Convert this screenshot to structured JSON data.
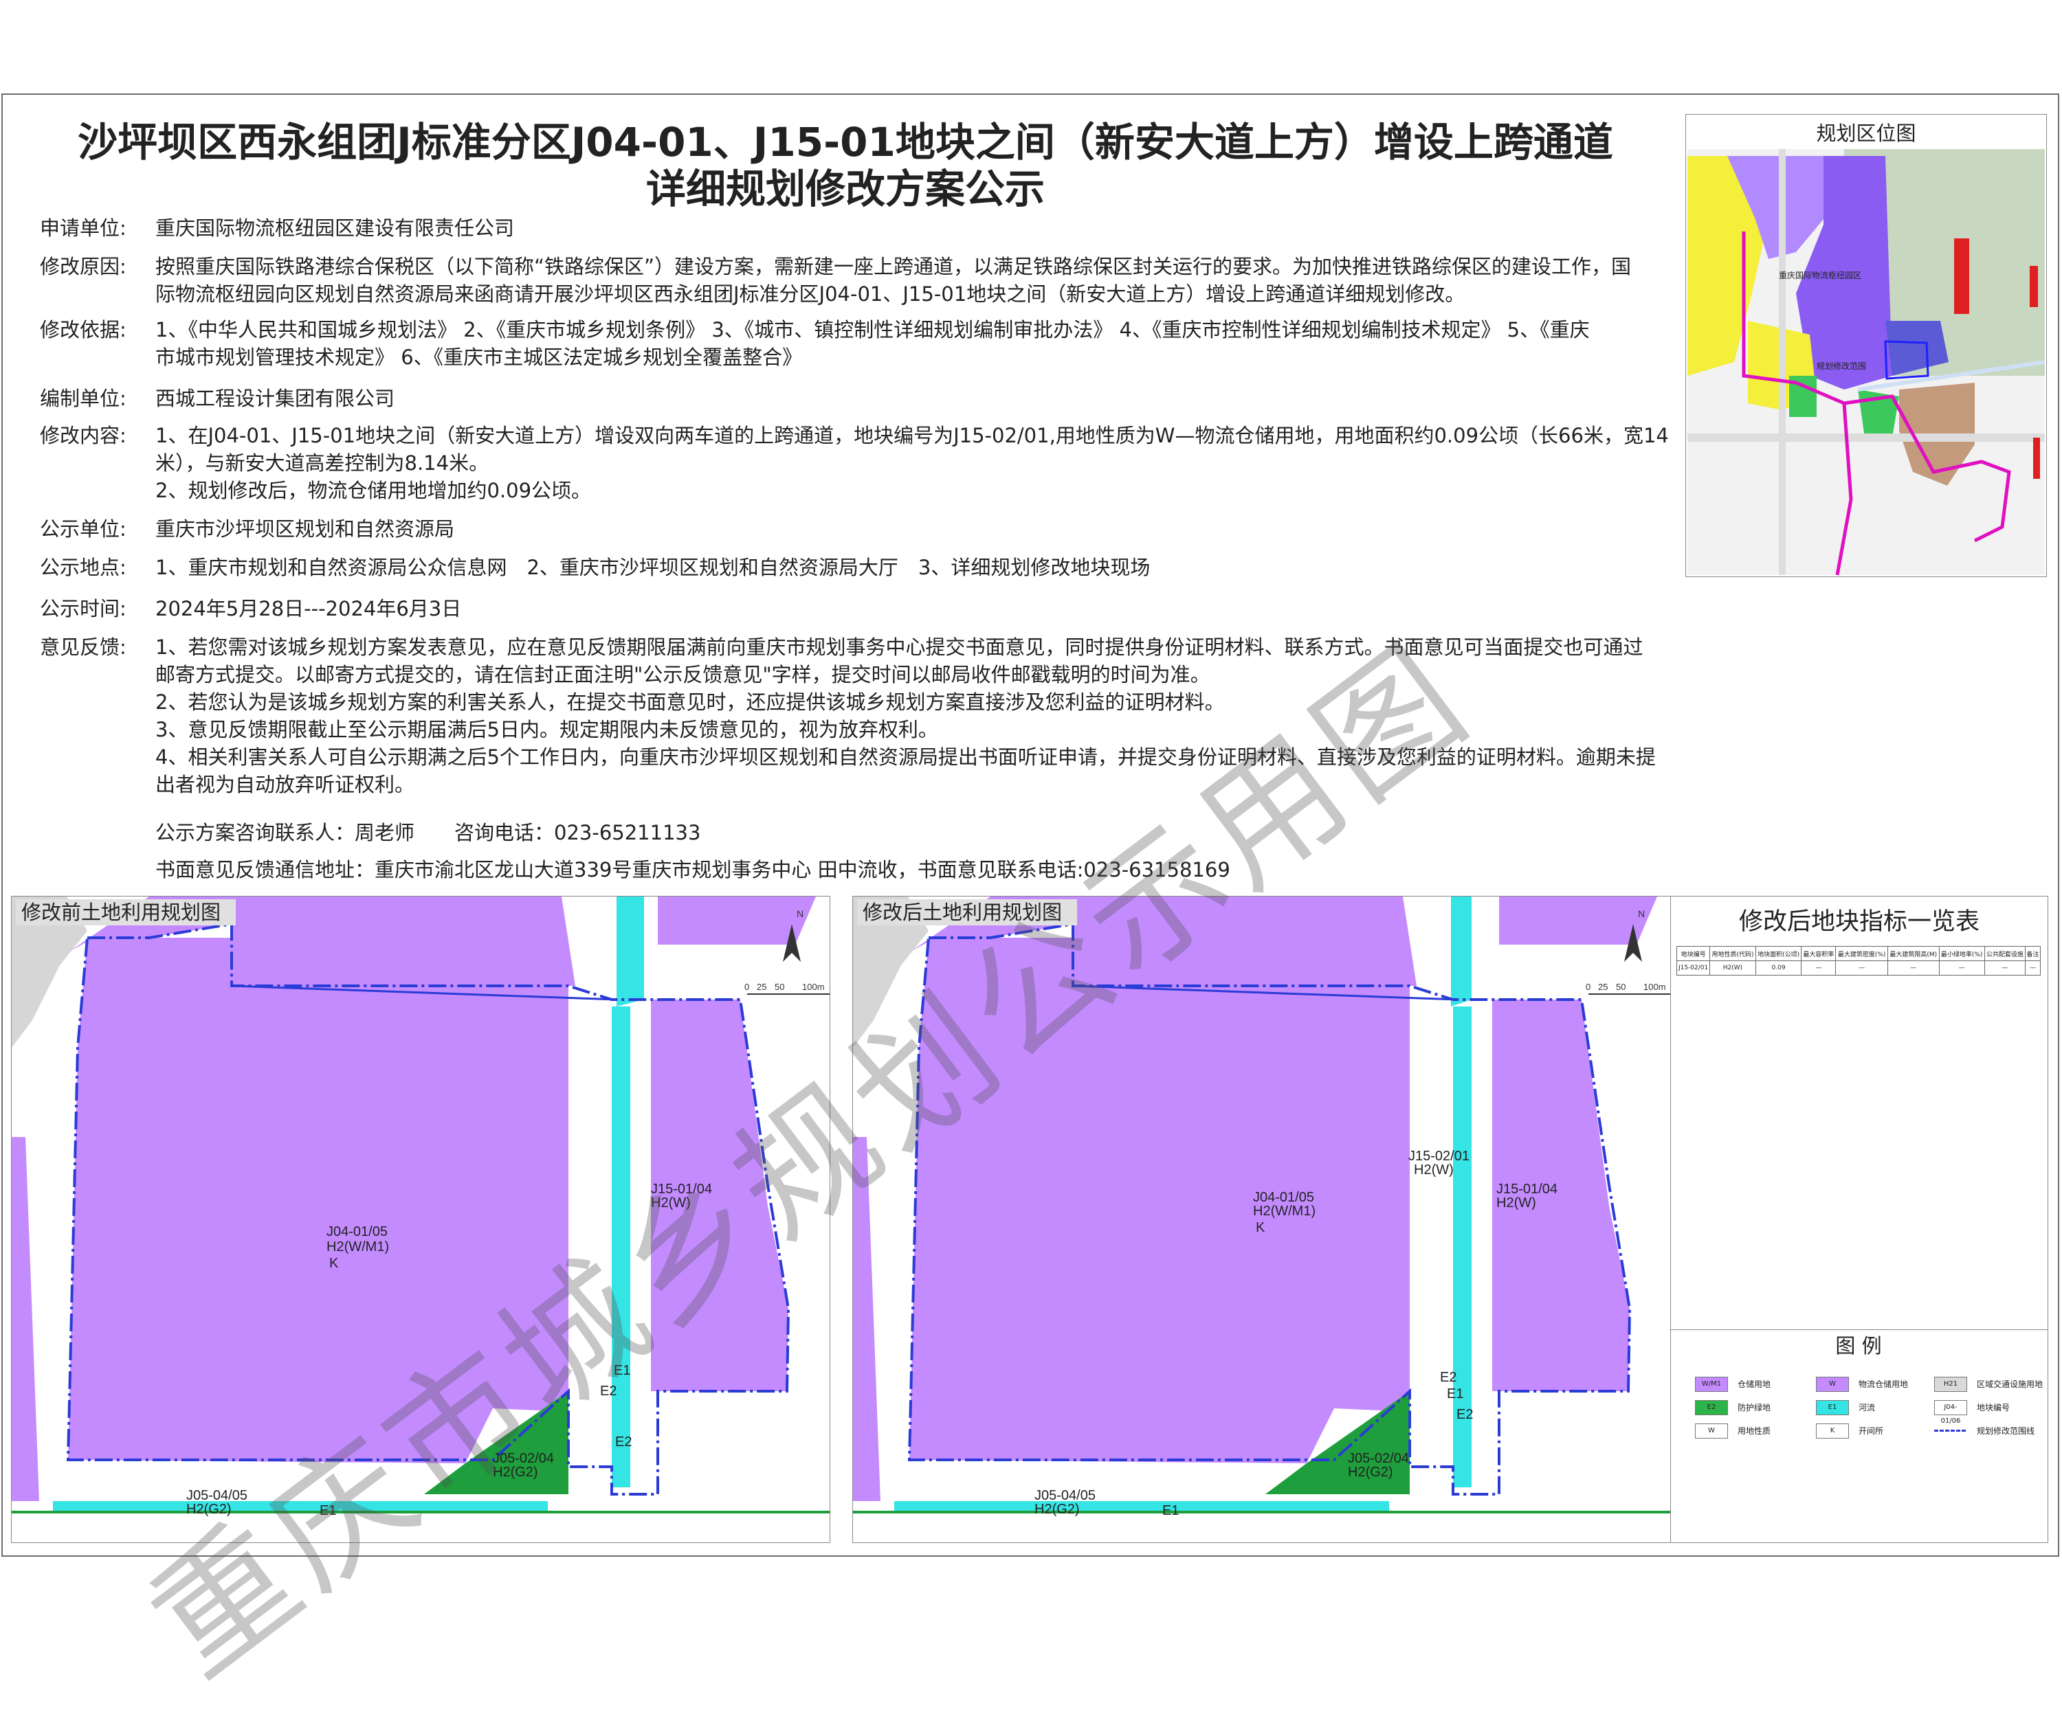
{
  "title_line1": "沙坪坝区西永组团J标准分区J04-01、J15-01地块之间（新安大道上方）增设上跨通道",
  "title_line2": "详细规划修改方案公示",
  "rows": [
    {
      "label": "申请单位:",
      "lines": [
        "重庆国际物流枢纽园区建设有限责任公司"
      ]
    },
    {
      "label": "修改原因:",
      "lines": [
        "按照重庆国际铁路港综合保税区（以下简称“铁路综保区”）建设方案，需新建一座上跨通道，以满足铁路综保区封关运行的要求。为加快推进铁路综保区的建设工作，国",
        "际物流枢纽园向区规划自然资源局来函商请开展沙坪坝区西永组团J标准分区J04-01、J15-01地块之间（新安大道上方）增设上跨通道详细规划修改。"
      ]
    },
    {
      "label": "修改依据:",
      "lines": [
        "1、《中华人民共和国城乡规划法》 2、《重庆市城乡规划条例》 3、《城市、镇控制性详细规划编制审批办法》 4、《重庆市控制性详细规划编制技术规定》 5、《重庆",
        "市城市规划管理技术规定》 6、《重庆市主城区法定城乡规划全覆盖整合》"
      ]
    },
    {
      "label": "编制单位:",
      "lines": [
        "西城工程设计集团有限公司"
      ]
    },
    {
      "label": "修改内容:",
      "lines": [
        "1、在J04-01、J15-01地块之间（新安大道上方）增设双向两车道的上跨通道，地块编号为J15-02/01,用地性质为W—物流仓储用地，用地面积约0.09公顷（长66米，宽14",
        "米），与新安大道高差控制为8.14米。",
        "2、规划修改后，物流仓储用地增加约0.09公顷。"
      ]
    },
    {
      "label": "公示单位:",
      "lines": [
        "重庆市沙坪坝区规划和自然资源局"
      ]
    },
    {
      "label": "公示地点:",
      "lines": [
        "1、重庆市规划和自然资源局公众信息网　2、重庆市沙坪坝区规划和自然资源局大厅　3、详细规划修改地块现场"
      ]
    },
    {
      "label": "公示时间:",
      "lines": [
        "2024年5月28日---2024年6月3日"
      ]
    },
    {
      "label": "意见反馈:",
      "lines": [
        "1、若您需对该城乡规划方案发表意见，应在意见反馈期限届满前向重庆市规划事务中心提交书面意见，同时提供身份证明材料、联系方式。书面意见可当面提交也可通过",
        "邮寄方式提交。以邮寄方式提交的，请在信封正面注明\"公示反馈意见\"字样，提交时间以邮局收件邮戳载明的时间为准。",
        "2、若您认为是该城乡规划方案的利害关系人，在提交书面意见时，还应提供该城乡规划方案直接涉及您利益的证明材料。",
        "3、意见反馈期限截止至公示期届满后5日内。规定期限内未反馈意见的，视为放弃权利。",
        "4、相关利害关系人可自公示期满之后5个工作日内，向重庆市沙坪坝区规划和自然资源局提出书面听证申请，并提交身份证明材料、直接涉及您利益的证明材料。逾期未提",
        "出者视为自动放弃听证权利。"
      ]
    }
  ],
  "contact": "公示方案咨询联系人：周老师　　咨询电话：023-65211133",
  "address": "书面意见反馈通信地址：重庆市渝北区龙山大道339号重庆市规划事务中心 田中流收，书面意见联系电话:023-63158169",
  "inset": {
    "title": "规划区位图",
    "label_park": "重庆国际物流枢纽园区",
    "label_scope": "规划修改范围"
  },
  "panel_before": {
    "title": "修改前土地利用规划图",
    "labels": {
      "main_code": "J04-01/05",
      "main_use": "H2(W/M1)",
      "main_k": "K",
      "east_code": "J15-01/04",
      "east_use": "H2(W)",
      "g_code": "J05-02/04",
      "g_use": "H2(G2)",
      "s_code": "J05-04/05",
      "s_use": "H2(G2)",
      "e1a": "E1",
      "e2a": "E2",
      "e2b": "E2",
      "e1b": "E1"
    }
  },
  "panel_after": {
    "title": "修改后土地利用规划图",
    "labels": {
      "main_code": "J04-01/05",
      "main_use": "H2(W/M1)",
      "main_k": "K",
      "east_code": "J15-01/04",
      "east_use": "H2(W)",
      "new_code": "J15-02/01",
      "new_use": "H2(W)",
      "g_code": "J05-02/04",
      "g_use": "H2(G2)",
      "s_code": "J05-04/05",
      "s_use": "H2(G2)",
      "e2a": "E2",
      "e1a": "E1",
      "e2b": "E2",
      "e1b": "E1"
    }
  },
  "scalebar": {
    "ticks": [
      "0",
      "25",
      "50",
      "100m"
    ],
    "north": "N"
  },
  "table": {
    "title": "修改后地块指标一览表",
    "headers": [
      "地块编号",
      "用地性质(代码)",
      "地块面积(公顷)",
      "最大容积率",
      "最大建筑密度(%)",
      "最大建筑限高(M)",
      "最小绿地率(%)",
      "公共配套设施",
      "备注"
    ],
    "rows": [
      [
        "J15-02/01",
        "H2(W)",
        "0.09",
        "—",
        "—",
        "—",
        "—",
        "—",
        "—"
      ]
    ]
  },
  "legend": {
    "title": "图 例",
    "items": [
      {
        "code": "W/M1",
        "text": "仓储用地",
        "color": "#c48bff"
      },
      {
        "code": "W",
        "text": "物流仓储用地",
        "color": "#c48bff"
      },
      {
        "code": "H21",
        "text": "区域交通设施用地",
        "color": "#d9d9d9"
      },
      {
        "code": "E2",
        "text": "防护绿地",
        "color": "#2db34a"
      },
      {
        "code": "E1",
        "text": "河流",
        "color": "#35e4e4"
      },
      {
        "code": "J04-01/06",
        "text": "地块编号",
        "color": "#ffffff"
      },
      {
        "code": "W",
        "text": "用地性质",
        "color": "#ffffff"
      },
      {
        "code": "K",
        "text": "开间所",
        "color": "#ffffff"
      },
      {
        "code": "",
        "text": "规划修改范围线",
        "color": "#2b3bd6"
      }
    ]
  },
  "watermark": "重庆市城乡规划公示用图",
  "colors": {
    "purple": "#c48bff",
    "green": "#1e9e3c",
    "cyan": "#35e4e4",
    "boundary": "#2b3bd6",
    "road": "#d6d6d6"
  }
}
